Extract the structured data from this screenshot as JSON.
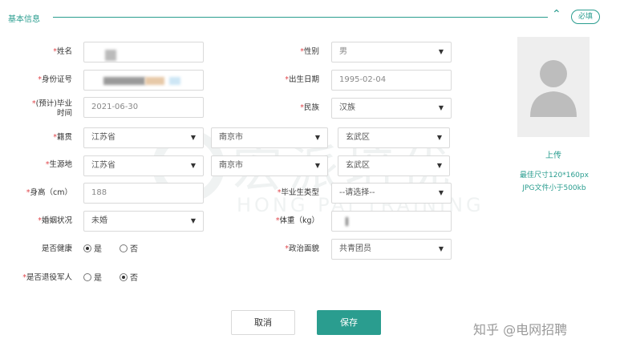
{
  "section": {
    "title": "基本信息",
    "required_badge": "必填"
  },
  "labels": {
    "name": "姓名",
    "gender": "性别",
    "id_number": "身份证号",
    "birth_date": "出生日期",
    "grad_time_1": "(预计)毕业",
    "grad_time_2": "时间",
    "ethnicity": "民族",
    "native_place": "籍贯",
    "origin": "生源地",
    "height": "身高（cm）",
    "grad_type": "毕业生类型",
    "marital": "婚姻状况",
    "weight": "体重（kg）",
    "healthy": "是否健康",
    "political": "政治面貌",
    "veteran": "是否退役军人"
  },
  "required_mark": "*",
  "values": {
    "gender": "男",
    "birth_date": "1995-02-04",
    "grad_time": "2021-06-30",
    "ethnicity": "汉族",
    "native_province": "江苏省",
    "native_city": "南京市",
    "native_district": "玄武区",
    "origin_province": "江苏省",
    "origin_city": "南京市",
    "origin_district": "玄武区",
    "height": "188",
    "grad_type": "--请选择--",
    "marital": "未婚",
    "political": "共青团员"
  },
  "radio": {
    "yes": "是",
    "no": "否",
    "healthy_selected": "yes",
    "veteran_selected": "no"
  },
  "photo": {
    "upload_label": "上传",
    "hint_size": "最佳尺寸120*160px",
    "hint_format": "JPG文件小于500kb"
  },
  "buttons": {
    "cancel": "取消",
    "save": "保存"
  },
  "watermark": {
    "cn": "宏派培优",
    "en": "HONG PAI TRAINING"
  },
  "credit": "知乎 @电网招聘",
  "colors": {
    "accent": "#2a9d8f",
    "required": "#e0454a"
  }
}
